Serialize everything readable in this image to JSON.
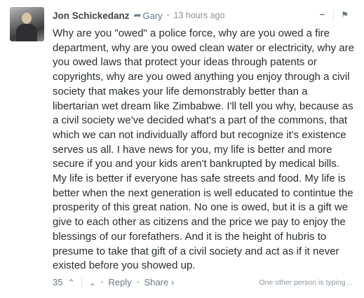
{
  "comment": {
    "author": "Jon Schickedanz",
    "reply_to": "Gary",
    "timestamp": "13 hours ago",
    "collapse_symbol": "−",
    "flag_symbol": "⚑",
    "reply_arrow_symbol": "➦",
    "body": "Why are you \"owed\" a police force, why are you owed a fire department, why are you owed clean water or electricity, why are you owed laws that protect your ideas through patents or copyrights, why are you owed anything you enjoy through a civil society that makes your life demonstrably better than a libertarian wet dream like Zimbabwe. I'll tell you why, because as a civil society we've decided what's a part of the commons, that which we can not individually afford but recognize it's existence serves us all. I have news for you, my life is better and more secure if you and your kids aren't bankrupted by medical bills. My life is better if everyone has safe streets and food. My life is better when the next generation is well educated to contintue the prosperity of this great nation. No one is owed, but it is a gift we give to each other as citizens and the price we pay to enjoy the blessings of our forefathers. And it is the height of hubris to presume to take that gift of a civil society and act as if it never existed before you showed up."
  },
  "footer": {
    "votes": "35",
    "upvote_symbol": "⌃",
    "downvote_symbol": "⌄",
    "reply_label": "Reply",
    "share_label": "Share ›",
    "typing_status": "One other person is typing…"
  }
}
